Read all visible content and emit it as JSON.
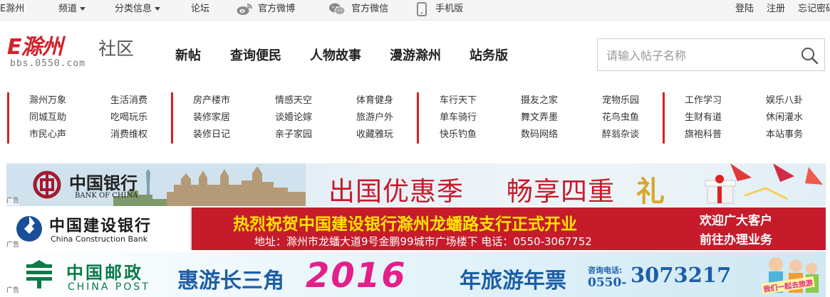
{
  "colors": {
    "brand_red": "#d2212a",
    "ccb_blue": "#1a4e9b",
    "post_green": "#0a7a4a",
    "banner_red": "#c61b2b"
  },
  "topbar": {
    "city": "E滁州",
    "channel": "频道",
    "category_info": "分类信息",
    "forum": "论坛",
    "weibo": "官方微博",
    "weixin": "官方微信",
    "mobile": "手机版",
    "login": "登陆",
    "register": "注册",
    "forgot": "忘记密码"
  },
  "header": {
    "logo_main": "E滁州",
    "logo_sub": "社区",
    "logo_url": "bbs.0550.com",
    "nav": [
      "新帖",
      "查询便民",
      "人物故事",
      "漫游滁州",
      "站务版"
    ],
    "search_placeholder": "请输入帖子名称",
    "search_icon": "search-icon"
  },
  "categories": [
    [
      "滁州万象",
      "同城互助",
      "市民心声"
    ],
    [
      "生活消费",
      "吃喝玩乐",
      "消费维权"
    ],
    [
      "房产楼市",
      "装修家居",
      "装修日记"
    ],
    [
      "情感天空",
      "谈婚论嫁",
      "亲子家园"
    ],
    [
      "体育健身",
      "旅游户外",
      "收藏雅玩"
    ],
    [
      "车行天下",
      "单车骑行",
      "快乐钓鱼"
    ],
    [
      "摄友之家",
      "舞文弄墨",
      "数码网络"
    ],
    [
      "宠物乐园",
      "花鸟虫鱼",
      "醉翁杂谈"
    ],
    [
      "工作学习",
      "生财有道",
      "旗袍科普"
    ],
    [
      "娱乐八卦",
      "休闲灌水",
      "本站事务"
    ]
  ],
  "banners": {
    "ad_label": "广告",
    "boc": {
      "name_cn": "中国银行",
      "name_en": "BANK OF CHINA",
      "slogan_a": "出国优惠季",
      "slogan_b": "畅享四重",
      "slogan_c": "礼"
    },
    "ccb": {
      "name_cn": "中国建设银行",
      "name_en": "China Construction Bank",
      "headline": "热烈祝贺中国建设银行滁州龙蟠路支行正式开业",
      "address": "地址：滁州市龙蟠大道9号金鹏99城市广场楼下   电话：0550-3067752",
      "welcome_1": "欢迎广大客户",
      "welcome_2": "前往办理业务"
    },
    "post": {
      "name_cn": "中国邮政",
      "name_en": "CHINA POST",
      "text_a": "惠游长三角",
      "year": "2016",
      "text_b": "年旅游年票",
      "hotline_label": "咨询电话:",
      "area_code": "0550-",
      "phone": "3073217",
      "sticker": "我们一起去旅游"
    }
  }
}
